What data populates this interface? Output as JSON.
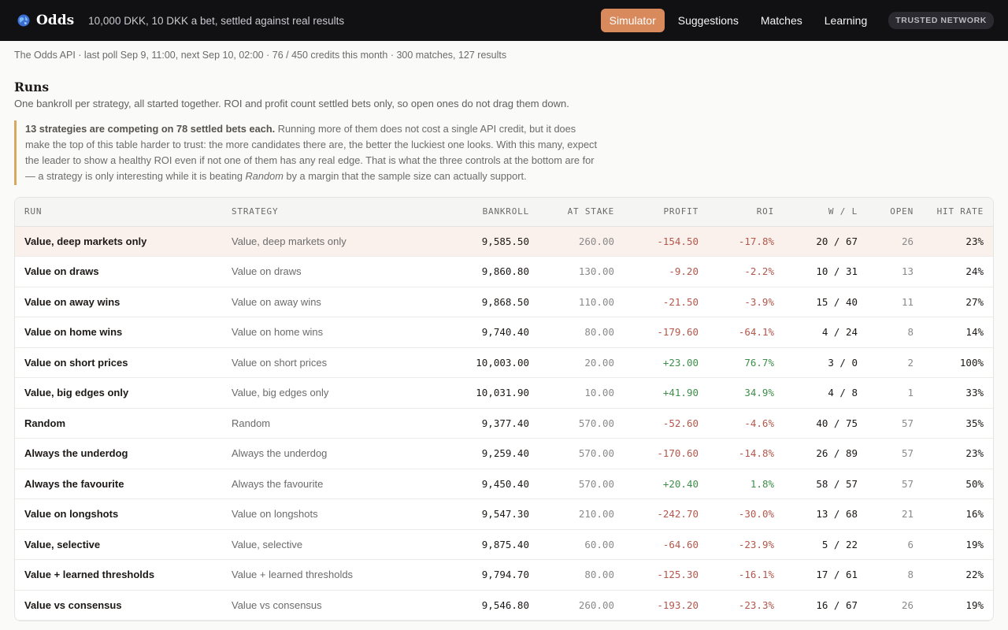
{
  "header": {
    "brand": "Odds",
    "tagline": "10,000 DKK, 10 DKK a bet, settled against real results",
    "nav": [
      {
        "label": "Simulator",
        "active": true
      },
      {
        "label": "Suggestions",
        "active": false
      },
      {
        "label": "Matches",
        "active": false
      },
      {
        "label": "Learning",
        "active": false
      }
    ],
    "badge": "TRUSTED NETWORK"
  },
  "status": "The Odds API · last poll Sep 9, 11:00, next Sep 10, 02:00 · 76 / 450 credits this month · 300 matches, 127 results",
  "runs": {
    "title": "Runs",
    "subtitle": "One bankroll per strategy, all started together. ROI and profit count settled bets only, so open ones do not drag them down.",
    "callout_bold": "13 strategies are competing on 78 settled bets each.",
    "callout_text": " Running more of them does not cost a single API credit, but it does make the top of this table harder to trust: the more candidates there are, the better the luckiest one looks. With this many, expect the leader to show a healthy ROI even if not one of them has any real edge. That is what the three controls at the bottom are for — a strategy is only interesting while it is beating ",
    "callout_em": "Random",
    "callout_end": " by a margin that the sample size can actually support."
  },
  "table": {
    "columns": [
      "RUN",
      "STRATEGY",
      "BANKROLL",
      "AT STAKE",
      "PROFIT",
      "ROI",
      "W / L",
      "OPEN",
      "HIT RATE"
    ],
    "rows": [
      {
        "run": "Value, deep markets only",
        "strategy": "Value, deep markets only",
        "bankroll": "9,585.50",
        "stake": "260.00",
        "profit": "-154.50",
        "roi": "-17.8%",
        "wl": "20 / 67",
        "open": "26",
        "hit": "23%",
        "sign": "neg",
        "highlight": true
      },
      {
        "run": "Value on draws",
        "strategy": "Value on draws",
        "bankroll": "9,860.80",
        "stake": "130.00",
        "profit": "-9.20",
        "roi": "-2.2%",
        "wl": "10 / 31",
        "open": "13",
        "hit": "24%",
        "sign": "neg"
      },
      {
        "run": "Value on away wins",
        "strategy": "Value on away wins",
        "bankroll": "9,868.50",
        "stake": "110.00",
        "profit": "-21.50",
        "roi": "-3.9%",
        "wl": "15 / 40",
        "open": "11",
        "hit": "27%",
        "sign": "neg"
      },
      {
        "run": "Value on home wins",
        "strategy": "Value on home wins",
        "bankroll": "9,740.40",
        "stake": "80.00",
        "profit": "-179.60",
        "roi": "-64.1%",
        "wl": "4 / 24",
        "open": "8",
        "hit": "14%",
        "sign": "neg"
      },
      {
        "run": "Value on short prices",
        "strategy": "Value on short prices",
        "bankroll": "10,003.00",
        "stake": "20.00",
        "profit": "+23.00",
        "roi": "76.7%",
        "wl": "3 / 0",
        "open": "2",
        "hit": "100%",
        "sign": "pos"
      },
      {
        "run": "Value, big edges only",
        "strategy": "Value, big edges only",
        "bankroll": "10,031.90",
        "stake": "10.00",
        "profit": "+41.90",
        "roi": "34.9%",
        "wl": "4 / 8",
        "open": "1",
        "hit": "33%",
        "sign": "pos"
      },
      {
        "run": "Random",
        "strategy": "Random",
        "bankroll": "9,377.40",
        "stake": "570.00",
        "profit": "-52.60",
        "roi": "-4.6%",
        "wl": "40 / 75",
        "open": "57",
        "hit": "35%",
        "sign": "neg"
      },
      {
        "run": "Always the underdog",
        "strategy": "Always the underdog",
        "bankroll": "9,259.40",
        "stake": "570.00",
        "profit": "-170.60",
        "roi": "-14.8%",
        "wl": "26 / 89",
        "open": "57",
        "hit": "23%",
        "sign": "neg"
      },
      {
        "run": "Always the favourite",
        "strategy": "Always the favourite",
        "bankroll": "9,450.40",
        "stake": "570.00",
        "profit": "+20.40",
        "roi": "1.8%",
        "wl": "58 / 57",
        "open": "57",
        "hit": "50%",
        "sign": "pos"
      },
      {
        "run": "Value on longshots",
        "strategy": "Value on longshots",
        "bankroll": "9,547.30",
        "stake": "210.00",
        "profit": "-242.70",
        "roi": "-30.0%",
        "wl": "13 / 68",
        "open": "21",
        "hit": "16%",
        "sign": "neg"
      },
      {
        "run": "Value, selective",
        "strategy": "Value, selective",
        "bankroll": "9,875.40",
        "stake": "60.00",
        "profit": "-64.60",
        "roi": "-23.9%",
        "wl": "5 / 22",
        "open": "6",
        "hit": "19%",
        "sign": "neg"
      },
      {
        "run": "Value + learned thresholds",
        "strategy": "Value + learned thresholds",
        "bankroll": "9,794.70",
        "stake": "80.00",
        "profit": "-125.30",
        "roi": "-16.1%",
        "wl": "17 / 61",
        "open": "8",
        "hit": "22%",
        "sign": "neg"
      },
      {
        "run": "Value vs consensus",
        "strategy": "Value vs consensus",
        "bankroll": "9,546.80",
        "stake": "260.00",
        "profit": "-193.20",
        "roi": "-23.3%",
        "wl": "16 / 67",
        "open": "26",
        "hit": "19%",
        "sign": "neg"
      }
    ]
  },
  "colors": {
    "accent": "#d98a5c",
    "negative": "#b4574c",
    "positive": "#3f8f4a",
    "callout_border": "#d8a760"
  }
}
